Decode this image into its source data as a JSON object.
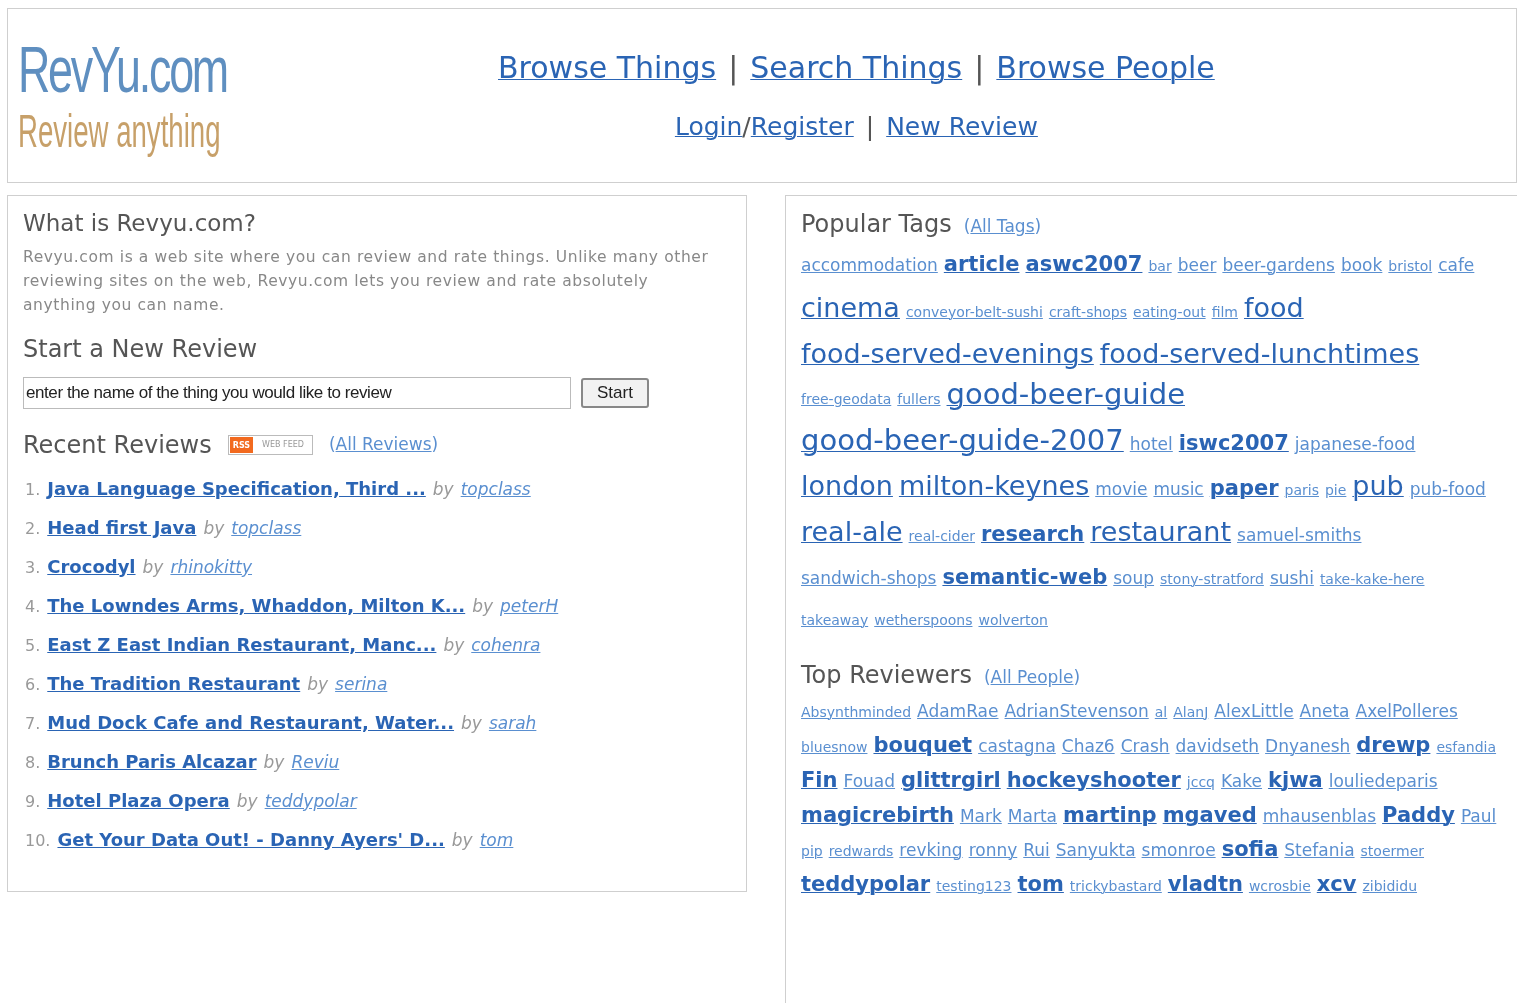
{
  "logo": {
    "name": "RevYu.com",
    "tagline": "Review anything"
  },
  "nav": {
    "primary": [
      {
        "label": "Browse Things",
        "kind": "link"
      },
      {
        "label": "|",
        "kind": "separator"
      },
      {
        "label": "Search Things",
        "kind": "link"
      },
      {
        "label": "|",
        "kind": "separator"
      },
      {
        "label": "Browse People",
        "kind": "link"
      }
    ],
    "secondary": [
      {
        "label": "Login",
        "kind": "link"
      },
      {
        "label": "/",
        "kind": "joiner"
      },
      {
        "label": "Register",
        "kind": "link"
      },
      {
        "label": "|",
        "kind": "separator"
      },
      {
        "label": "New Review",
        "kind": "link"
      }
    ]
  },
  "about": {
    "title": "What is Revyu.com?",
    "text": "Revyu.com is a web site where you can review and rate things. Unlike many other reviewing sites on the web, Revyu.com lets you review and rate absolutely anything you can name."
  },
  "new_review": {
    "title": "Start a New Review",
    "value": "enter the name of the thing you would like to review",
    "button": "Start"
  },
  "recent": {
    "title": "Recent Reviews",
    "feed_badge": {
      "left": "RSS",
      "right": "WEB FEED"
    },
    "open": "(",
    "all_link": "All Reviews",
    "close": ")",
    "items": [
      {
        "number": "1.",
        "title": "Java Language Specification, Third ...",
        "by": "by",
        "author": "topclass"
      },
      {
        "number": "2.",
        "title": "Head first Java",
        "by": "by",
        "author": "topclass"
      },
      {
        "number": "3.",
        "title": "Crocodyl",
        "by": "by",
        "author": "rhinokitty"
      },
      {
        "number": "4.",
        "title": "The Lowndes Arms, Whaddon, Milton K...",
        "by": "by",
        "author": "peterH"
      },
      {
        "number": "5.",
        "title": "East Z East Indian Restaurant, Manc...",
        "by": "by",
        "author": "cohenra"
      },
      {
        "number": "6.",
        "title": "The Tradition Restaurant",
        "by": "by",
        "author": "serina"
      },
      {
        "number": "7.",
        "title": "Mud Dock Cafe and Restaurant, Water...",
        "by": "by",
        "author": "sarah"
      },
      {
        "number": "8.",
        "title": "Brunch Paris Alcazar",
        "by": "by",
        "author": "Reviu"
      },
      {
        "number": "9.",
        "title": "Hotel Plaza Opera",
        "by": "by",
        "author": "teddypolar"
      },
      {
        "number": "10.",
        "title": "Get Your Data Out! - Danny Ayers' D...",
        "by": "by",
        "author": "tom"
      }
    ]
  },
  "tags": {
    "title": "Popular Tags",
    "open": "(",
    "all_link": "All Tags",
    "close": ")",
    "items": [
      {
        "label": "accommodation",
        "kind": "small"
      },
      {
        "label": "article",
        "kind": "bold"
      },
      {
        "label": "aswc2007",
        "kind": "bold"
      },
      {
        "label": "bar",
        "kind": "tiny"
      },
      {
        "label": "beer",
        "kind": "small"
      },
      {
        "label": "beer-gardens",
        "kind": "small"
      },
      {
        "label": "book",
        "kind": "small"
      },
      {
        "label": "bristol",
        "kind": "tiny"
      },
      {
        "label": "cafe",
        "kind": "small"
      },
      {
        "label": "cinema",
        "kind": "large"
      },
      {
        "label": "conveyor-belt-sushi",
        "kind": "tiny"
      },
      {
        "label": "craft-shops",
        "kind": "tiny"
      },
      {
        "label": "eating-out",
        "kind": "tiny"
      },
      {
        "label": "film",
        "kind": "tiny"
      },
      {
        "label": "food",
        "kind": "large"
      },
      {
        "label": "food-served-evenings",
        "kind": "large"
      },
      {
        "label": "food-served-lunchtimes",
        "kind": "large"
      },
      {
        "label": "free-geodata",
        "kind": "tiny"
      },
      {
        "label": "fullers",
        "kind": "tiny"
      },
      {
        "label": "good-beer-guide",
        "kind": "huge"
      },
      {
        "label": "good-beer-guide-2007",
        "kind": "huge"
      },
      {
        "label": "hotel",
        "kind": "small"
      },
      {
        "label": "iswc2007",
        "kind": "bold"
      },
      {
        "label": "japanese-food",
        "kind": "small"
      },
      {
        "label": "london",
        "kind": "large"
      },
      {
        "label": "milton-keynes",
        "kind": "large"
      },
      {
        "label": "movie",
        "kind": "small"
      },
      {
        "label": "music",
        "kind": "small"
      },
      {
        "label": "paper",
        "kind": "bold"
      },
      {
        "label": "paris",
        "kind": "tiny"
      },
      {
        "label": "pie",
        "kind": "tiny"
      },
      {
        "label": "pub",
        "kind": "large"
      },
      {
        "label": "pub-food",
        "kind": "small"
      },
      {
        "label": "real-ale",
        "kind": "large"
      },
      {
        "label": "real-cider",
        "kind": "tiny"
      },
      {
        "label": "research",
        "kind": "bold"
      },
      {
        "label": "restaurant",
        "kind": "large"
      },
      {
        "label": "samuel-smiths",
        "kind": "small"
      },
      {
        "label": "sandwich-shops",
        "kind": "small"
      },
      {
        "label": "semantic-web",
        "kind": "bold"
      },
      {
        "label": "soup",
        "kind": "small"
      },
      {
        "label": "stony-stratford",
        "kind": "tiny"
      },
      {
        "label": "sushi",
        "kind": "small"
      },
      {
        "label": "take-kake-here",
        "kind": "tiny"
      },
      {
        "label": "takeaway",
        "kind": "tiny"
      },
      {
        "label": "wetherspoons",
        "kind": "tiny"
      },
      {
        "label": "wolverton",
        "kind": "tiny"
      }
    ]
  },
  "reviewers": {
    "title": "Top Reviewers",
    "open": "(",
    "all_link": "All People",
    "close": ")",
    "items": [
      {
        "label": "Absynthminded",
        "kind": "tiny"
      },
      {
        "label": "AdamRae",
        "kind": "small"
      },
      {
        "label": "AdrianStevenson",
        "kind": "small"
      },
      {
        "label": "al",
        "kind": "tiny"
      },
      {
        "label": "AlanJ",
        "kind": "tiny"
      },
      {
        "label": "AlexLittle",
        "kind": "small"
      },
      {
        "label": "Aneta",
        "kind": "small"
      },
      {
        "label": "AxelPolleres",
        "kind": "small"
      },
      {
        "label": "bluesnow",
        "kind": "tiny"
      },
      {
        "label": "bouquet",
        "kind": "bold"
      },
      {
        "label": "castagna",
        "kind": "small"
      },
      {
        "label": "Chaz6",
        "kind": "small"
      },
      {
        "label": "Crash",
        "kind": "small"
      },
      {
        "label": "davidseth",
        "kind": "small"
      },
      {
        "label": "Dnyanesh",
        "kind": "small"
      },
      {
        "label": "drewp",
        "kind": "bold"
      },
      {
        "label": "esfandia",
        "kind": "tiny"
      },
      {
        "label": "Fin",
        "kind": "bold"
      },
      {
        "label": "Fouad",
        "kind": "small"
      },
      {
        "label": "glittrgirl",
        "kind": "bold"
      },
      {
        "label": "hockeyshooter",
        "kind": "bold"
      },
      {
        "label": "jccq",
        "kind": "tiny"
      },
      {
        "label": "Kake",
        "kind": "small"
      },
      {
        "label": "kjwa",
        "kind": "bold"
      },
      {
        "label": "louliedeparis",
        "kind": "small"
      },
      {
        "label": "magicrebirth",
        "kind": "bold"
      },
      {
        "label": "Mark",
        "kind": "small"
      },
      {
        "label": "Marta",
        "kind": "small"
      },
      {
        "label": "martinp",
        "kind": "bold"
      },
      {
        "label": "mgaved",
        "kind": "bold"
      },
      {
        "label": "mhausenblas",
        "kind": "small"
      },
      {
        "label": "Paddy",
        "kind": "bold"
      },
      {
        "label": "Paul",
        "kind": "small"
      },
      {
        "label": "pip",
        "kind": "tiny"
      },
      {
        "label": "redwards",
        "kind": "tiny"
      },
      {
        "label": "revking",
        "kind": "small"
      },
      {
        "label": "ronny",
        "kind": "small"
      },
      {
        "label": "Rui",
        "kind": "small"
      },
      {
        "label": "Sanyukta",
        "kind": "small"
      },
      {
        "label": "smonroe",
        "kind": "small"
      },
      {
        "label": "sofia",
        "kind": "bold"
      },
      {
        "label": "Stefania",
        "kind": "small"
      },
      {
        "label": "stoermer",
        "kind": "tiny"
      },
      {
        "label": "teddypolar",
        "kind": "bold"
      },
      {
        "label": "testing123",
        "kind": "tiny"
      },
      {
        "label": "tom",
        "kind": "bold"
      },
      {
        "label": "trickybastard",
        "kind": "tiny"
      },
      {
        "label": "vladtn",
        "kind": "bold"
      },
      {
        "label": "wcrosbie",
        "kind": "tiny"
      },
      {
        "label": "xcv",
        "kind": "bold"
      },
      {
        "label": "zibididu",
        "kind": "tiny"
      }
    ]
  }
}
